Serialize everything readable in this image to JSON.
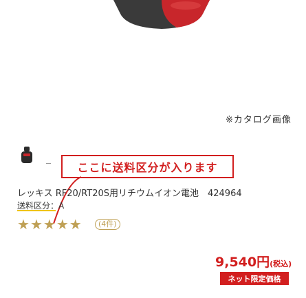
{
  "catalog_note": "※カタログ画像",
  "banner": {
    "text": "ここに送料区分が入ります"
  },
  "product": {
    "name": "レッキス RF20/RT20S用リチウムイオン電池　424964",
    "shipping_class": "送料区分：A",
    "rating": 5,
    "review_count": "(4件)",
    "price_value": "9,540円",
    "price_tax": "(税込)",
    "net_badge": "ネット限定価格"
  },
  "colors": {
    "accent": "#d21f1f",
    "star": "#bfa055",
    "shipping_underline": "#f0c400"
  },
  "icons": [
    "product-hero-image",
    "product-thumbnail",
    "star-icon"
  ]
}
